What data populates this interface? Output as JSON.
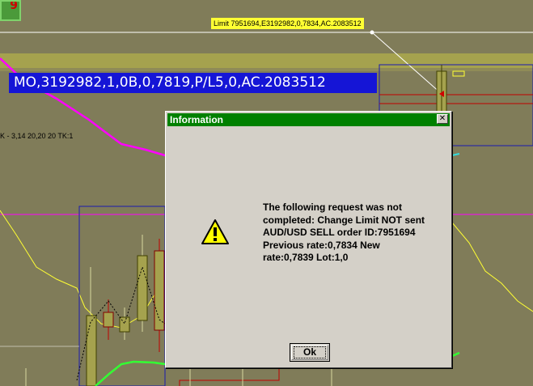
{
  "chart": {
    "corner_badge": "9",
    "limit_label": "Limit 7951694,E3192982,0,7834,AC.2083512",
    "order_banner": "MO,3192982,1,0B,0,7819,P/L5,0,AC.2083512",
    "indicator_text": "K - 3,14   20,20   20  TK:1",
    "colors": {
      "background": "#807c59",
      "band": "#a5a24e",
      "banner": "#1515d6",
      "limit_label": "#ffff33",
      "magenta_line": "#ff00ff",
      "green_line": "#33ff33"
    }
  },
  "dialog": {
    "title": "Information",
    "close_label": "✕",
    "icon": "warning-icon",
    "message_lines": [
      "The following request was not",
      "completed: Change Limit NOT sent",
      "AUD/USD SELL order ID:7951694",
      "Previous rate:0,7834 New",
      "rate:0,7839 Lot:1,0"
    ],
    "ok_label": "Ok",
    "titlebar_color": "#008000"
  }
}
